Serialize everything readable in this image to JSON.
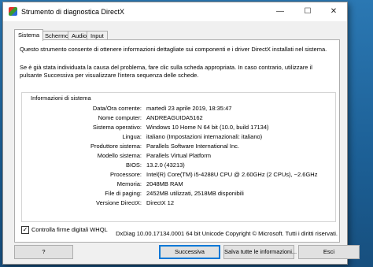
{
  "window": {
    "title": "Strumento di diagnostica DirectX"
  },
  "tabs": [
    "Sistema",
    "Schermo",
    "Audio",
    "Input"
  ],
  "description": {
    "line1": "Questo strumento consente di ottenere informazioni dettagliate sui componenti e i driver DirectX installati nel sistema.",
    "line2": "Se è già stata individuata la causa del problema, fare clic sulla scheda appropriata. In caso contrario, utilizzare il pulsante Successiva per visualizzare l'intera sequenza delle schede."
  },
  "system_info": {
    "title": "Informazioni di sistema",
    "rows": [
      {
        "label": "Data/Ora corrente:",
        "value": "martedì 23 aprile 2019, 18:35:47"
      },
      {
        "label": "Nome computer:",
        "value": "ANDREAGUIDA5162"
      },
      {
        "label": "Sistema operativo:",
        "value": "Windows 10 Home N 64 bit (10.0, build 17134)"
      },
      {
        "label": "Lingua:",
        "value": "italiano (Impostazioni internazionali: italiano)"
      },
      {
        "label": "Produttore sistema:",
        "value": "Parallels Software International Inc."
      },
      {
        "label": "Modello sistema:",
        "value": "Parallels Virtual Platform"
      },
      {
        "label": "BIOS:",
        "value": "13.2.0 (43213)"
      },
      {
        "label": "Processore:",
        "value": "Intel(R) Core(TM) i5-4288U CPU @ 2.60GHz (2 CPUs), ~2.6GHz"
      },
      {
        "label": "Memoria:",
        "value": "2048MB RAM"
      },
      {
        "label": "File di paging:",
        "value": "2452MB utilizzati, 2518MB disponibili"
      },
      {
        "label": "Versione DirectX:",
        "value": "DirectX 12"
      }
    ]
  },
  "checkbox": {
    "label": "Controlla firme digitali WHQL",
    "checked": true,
    "mark": "✓"
  },
  "footer": "DxDiag 10.00.17134.0001 64 bit Unicode  Copyright © Microsoft. Tutti i diritti riservati.",
  "buttons": {
    "help": "?",
    "next": "Successiva",
    "save": "Salva tutte le informazioni...",
    "exit": "Esci"
  },
  "window_controls": {
    "minimize": "—",
    "maximize": "☐",
    "close": "✕"
  }
}
